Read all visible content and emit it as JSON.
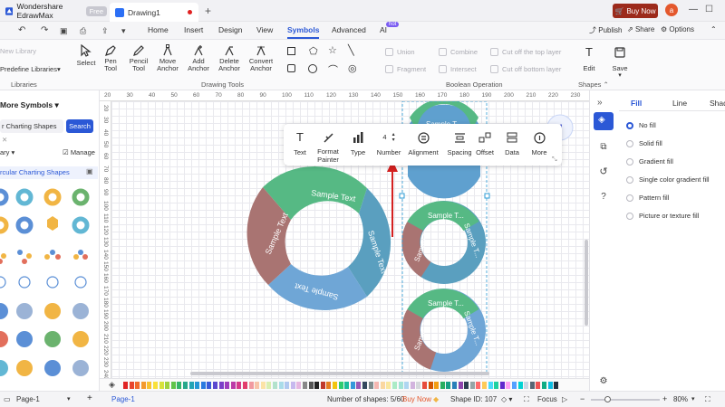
{
  "titlebar": {
    "app_name": "Wondershare EdrawMax",
    "free_badge": "Free",
    "doc_tab": "Drawing1",
    "buy_now": "Buy Now",
    "avatar_letter": "a"
  },
  "menubar": {
    "tabs": [
      "Home",
      "Insert",
      "Design",
      "View",
      "Symbols",
      "Advanced",
      "AI"
    ],
    "active_tab": "Symbols",
    "ai_badge": "hot",
    "publish": "Publish",
    "share": "Share",
    "options": "Options"
  },
  "ribbon": {
    "libraries": {
      "new_library": "New Library",
      "predefine": "Predefine Libraries",
      "group": "Libraries"
    },
    "drawing_tools": [
      "Select",
      "Pen Tool",
      "Pencil Tool",
      "Move Anchor",
      "Add Anchor",
      "Delete Anchor",
      "Convert Anchor"
    ],
    "drawing_group": "Drawing Tools",
    "boolean_ops": [
      "Union",
      "Combine",
      "Cut off the top layer",
      "Fragment",
      "Intersect",
      "Cut off bottom layer"
    ],
    "boolean_group": "Boolean Operation",
    "edit": "Edit",
    "save": "Save",
    "shapes": "Shapes"
  },
  "left_panel": {
    "title": "More Symbols",
    "search_value": "r Charting Shapes",
    "search_button": "Search",
    "library_label": "ary",
    "manage": "Manage",
    "selected_library": "rcular Charting Shapes"
  },
  "ruler": {
    "top": [
      "20",
      "30",
      "40",
      "50",
      "60",
      "70",
      "80",
      "90",
      "100",
      "110",
      "120",
      "130",
      "140",
      "150",
      "160",
      "170",
      "180",
      "190",
      "200",
      "210",
      "220",
      "230"
    ],
    "left": [
      "20",
      "30",
      "40",
      "50",
      "60",
      "70",
      "80",
      "90",
      "100",
      "110",
      "120",
      "130",
      "140",
      "150",
      "160",
      "170",
      "180",
      "190",
      "200",
      "210",
      "220",
      "230",
      "240"
    ]
  },
  "float_toolbar": {
    "items": [
      "Text",
      "Format Painter",
      "Type",
      "Number",
      "Alignment",
      "Spacing",
      "Offset",
      "Data",
      "More"
    ],
    "number_value": "4"
  },
  "diagram": {
    "big_labels": [
      "Sample Text",
      "Sample Text",
      "Sample Text",
      "Sample Text"
    ],
    "small_label": "Sample T..."
  },
  "right_panel": {
    "tabs": [
      "Fill",
      "Line",
      "Shad"
    ],
    "active_tab": "Fill",
    "fill_options": [
      "No fill",
      "Solid fill",
      "Gradient fill",
      "Single color gradient fill",
      "Pattern fill",
      "Picture or texture fill"
    ],
    "selected_option": "No fill"
  },
  "palette": [
    "#e02424",
    "#e8452c",
    "#f06a2a",
    "#f39a2c",
    "#f7c331",
    "#f9e03a",
    "#d7e23c",
    "#9fd23f",
    "#5fc44a",
    "#34b56a",
    "#27a88b",
    "#23a4b5",
    "#2596d6",
    "#2b7ae0",
    "#3b5bd9",
    "#5a48cf",
    "#7b3fc8",
    "#9d3dbd",
    "#bc3ba7",
    "#d63b8a",
    "#e23c6b",
    "#f19aa0",
    "#f7c4a8",
    "#fbe3a6",
    "#d9efb1",
    "#b3e2cc",
    "#a9dce9",
    "#b0c9f0",
    "#c7b9ee",
    "#e6b7e0",
    "#888888",
    "#555555",
    "#222222",
    "#c0392b",
    "#e67e22",
    "#f1c40f",
    "#2ecc71",
    "#1abc9c",
    "#3498db",
    "#9b59b6",
    "#34495e",
    "#7f8c8d",
    "#f5b7b1",
    "#fad7a0",
    "#f9e79f",
    "#abebc6",
    "#a3e4d7",
    "#aed6f1",
    "#d2b4de",
    "#d5d8dc",
    "#e74c3c",
    "#d35400",
    "#f39c12",
    "#27ae60",
    "#16a085",
    "#2980b9",
    "#8e44ad",
    "#2c3e50",
    "#95a5a6",
    "#ff6b6b",
    "#feca57",
    "#48dbfb",
    "#1dd1a1",
    "#5f27cd",
    "#ff9ff3",
    "#54a0ff",
    "#00d2d3",
    "#c8d6e5",
    "#576574",
    "#ee5253",
    "#10ac84",
    "#0abde3",
    "#222f3e"
  ],
  "statusbar": {
    "page_selector": "Page-1",
    "page_tab": "Page-1",
    "shapes_count": "Number of shapes: 5/60",
    "buy_now": "Buy Now",
    "shape_id": "Shape ID: 107",
    "focus": "Focus",
    "zoom": "80%"
  }
}
